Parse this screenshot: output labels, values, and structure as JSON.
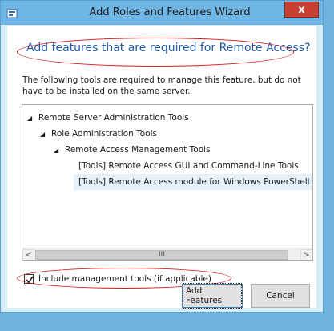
{
  "window": {
    "title": "Add Roles and Features Wizard",
    "close_label": "x"
  },
  "heading": "Add features that are required for Remote Access?",
  "description": "The following tools are required to manage this feature, but do not have to be installed on the same server.",
  "tree": {
    "items": [
      {
        "label": "Remote Server Administration Tools",
        "level": 0,
        "expanded": true
      },
      {
        "label": "Role Administration Tools",
        "level": 1,
        "expanded": true
      },
      {
        "label": "Remote Access Management Tools",
        "level": 2,
        "expanded": true
      },
      {
        "label": "[Tools] Remote Access GUI and Command-Line Tools",
        "level": 3,
        "expanded": false
      },
      {
        "label": "[Tools] Remote Access module for Windows PowerShell",
        "level": 3,
        "expanded": false,
        "selected": true
      }
    ],
    "expand_glyph": "◢",
    "scroll_left": "<",
    "scroll_right": ">",
    "scroll_thumb_grip": "III"
  },
  "include_tools": {
    "label": "Include management tools (if applicable)",
    "checked": true
  },
  "buttons": {
    "add_features": "Add Features",
    "cancel": "Cancel"
  },
  "colors": {
    "heading": "#1e5aa8",
    "annotation": "#d51b1b",
    "titlebar": "#6fb6e5",
    "close": "#c84031"
  }
}
